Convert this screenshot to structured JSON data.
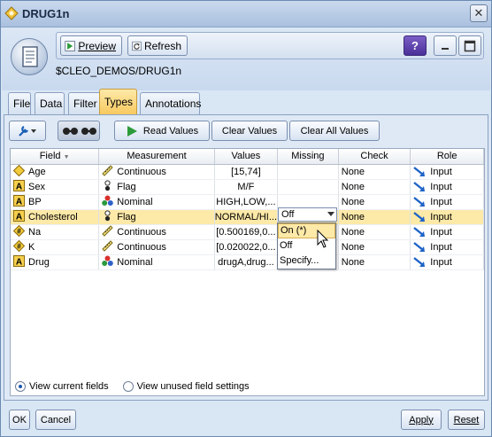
{
  "window": {
    "title": "DRUG1n",
    "close_glyph": "✕"
  },
  "toolbar": {
    "preview_label": "Preview",
    "refresh_label": "Refresh",
    "help_glyph": "?",
    "path": "$CLEO_DEMOS/DRUG1n"
  },
  "tabs": [
    "File",
    "Data",
    "Filter",
    "Types",
    "Annotations"
  ],
  "active_tab": "Types",
  "actions": {
    "read_values": "Read Values",
    "clear_values": "Clear Values",
    "clear_all_values": "Clear All Values"
  },
  "grid": {
    "columns": [
      "Field",
      "Measurement",
      "Values",
      "Missing",
      "Check",
      "Role"
    ],
    "sort_indicator": "▼",
    "rows": [
      {
        "field": "Age",
        "field_icon": "continuous-diamond-icon",
        "measurement": "Continuous",
        "measurement_icon": "ruler-icon",
        "values": "[15,74]",
        "missing": "",
        "check": "None",
        "role": "Input"
      },
      {
        "field": "Sex",
        "field_icon": "string-a-icon",
        "measurement": "Flag",
        "measurement_icon": "flag-icon",
        "values": "M/F",
        "missing": "",
        "check": "None",
        "role": "Input"
      },
      {
        "field": "BP",
        "field_icon": "string-a-icon",
        "measurement": "Nominal",
        "measurement_icon": "nominal-balls-icon",
        "values": "HIGH,LOW,...",
        "missing": "",
        "check": "None",
        "role": "Input"
      },
      {
        "field": "Cholesterol",
        "field_icon": "string-a-icon",
        "measurement": "Flag",
        "measurement_icon": "flag-icon",
        "values": "NORMAL/HI...",
        "missing": "Off",
        "check": "None",
        "role": "Input"
      },
      {
        "field": "Na",
        "field_icon": "number-icon",
        "measurement": "Continuous",
        "measurement_icon": "ruler-icon",
        "values": "[0.500169,0...",
        "missing": "",
        "check": "None",
        "role": "Input"
      },
      {
        "field": "K",
        "field_icon": "number-icon",
        "measurement": "Continuous",
        "measurement_icon": "ruler-icon",
        "values": "[0.020022,0...",
        "missing": "",
        "check": "None",
        "role": "Input"
      },
      {
        "field": "Drug",
        "field_icon": "string-a-icon",
        "measurement": "Nominal",
        "measurement_icon": "nominal-balls-icon",
        "values": "drugA,drug...",
        "missing": "",
        "check": "None",
        "role": "Input"
      }
    ],
    "selected_row": 3
  },
  "missing_dropdown": {
    "value": "Off",
    "options": [
      "On (*)",
      "Off",
      "Specify..."
    ],
    "highlighted": "On (*)"
  },
  "view_options": {
    "current": "View current fields",
    "unused": "View unused field settings",
    "selected": "current"
  },
  "buttons": {
    "ok": "OK",
    "cancel": "Cancel",
    "apply": "Apply",
    "reset": "Reset"
  },
  "colors": {
    "selection": "#fde9a8",
    "active_tab": "#f7c95f",
    "panel": "#dfe9f5"
  }
}
